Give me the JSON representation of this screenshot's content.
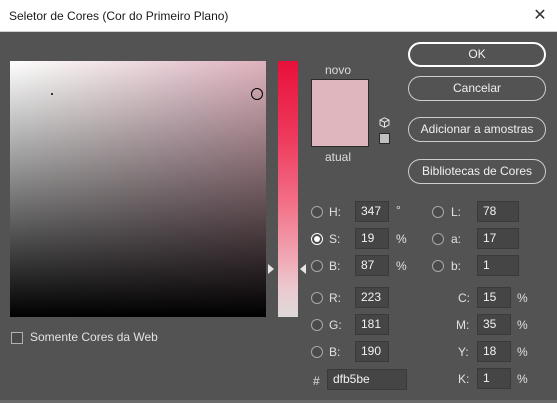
{
  "window": {
    "title": "Seletor de Cores (Cor do Primeiro Plano)",
    "close_glyph": "✕"
  },
  "preview": {
    "new_label": "novo",
    "current_label": "atual",
    "color": "#dfb5be"
  },
  "buttons": {
    "ok": "OK",
    "cancel": "Cancelar",
    "add_swatches": "Adicionar a amostras",
    "libraries": "Bibliotecas de Cores"
  },
  "web_only": {
    "label": "Somente Cores da Web",
    "checked": false
  },
  "hsb": {
    "h": {
      "label": "H:",
      "value": "347",
      "unit": "°",
      "selected": false
    },
    "s": {
      "label": "S:",
      "value": "19",
      "unit": "%",
      "selected": true
    },
    "b": {
      "label": "B:",
      "value": "87",
      "unit": "%",
      "selected": false
    }
  },
  "lab": {
    "l": {
      "label": "L:",
      "value": "78"
    },
    "a": {
      "label": "a:",
      "value": "17"
    },
    "b": {
      "label": "b:",
      "value": "1"
    }
  },
  "rgb": {
    "r": {
      "label": "R:",
      "value": "223"
    },
    "g": {
      "label": "G:",
      "value": "181"
    },
    "b": {
      "label": "B:",
      "value": "190"
    }
  },
  "cmyk": {
    "c": {
      "label": "C:",
      "value": "15",
      "unit": "%"
    },
    "m": {
      "label": "M:",
      "value": "35",
      "unit": "%"
    },
    "y": {
      "label": "Y:",
      "value": "18",
      "unit": "%"
    },
    "k": {
      "label": "K:",
      "value": "1",
      "unit": "%"
    }
  },
  "hex": {
    "label": "#",
    "value": "dfb5be"
  },
  "icons": {
    "close": "close-icon",
    "gamut_cube": "cube-icon",
    "web_safe": "web-safe-swatch-icon"
  }
}
